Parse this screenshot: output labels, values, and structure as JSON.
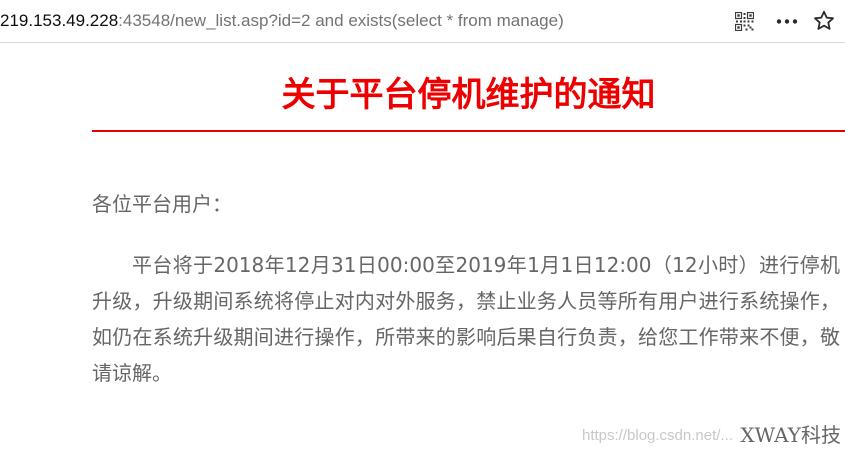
{
  "browser": {
    "address_host": "219.153.49.228",
    "address_rest": ":43548/new_list.asp?id=2 and exists(select * from manage)",
    "icons": [
      "qr-code-icon",
      "more-options-icon",
      "bookmark-star-icon"
    ]
  },
  "notice": {
    "title": "关于平台停机维护的通知",
    "greeting": "各位平台用户：",
    "body": "平台将于2018年12月31日00:00至2019年1月1日12:00（12小时）进行停机升级，升级期间系统将停止对内对外服务，禁止业务人员等所有用户进行系统操作，如仍在系统升级期间进行操作，所带来的影响后果自行负责，给您工作带来不便，敬请谅解。",
    "signature": "XWAY科技"
  },
  "watermark": {
    "text": "https://blog.csdn.net/..."
  },
  "colors": {
    "title": "#ee0000",
    "rule": "#e80000",
    "body_text": "#666666",
    "url_host": "#0c0c0d",
    "url_rest": "#737373"
  }
}
